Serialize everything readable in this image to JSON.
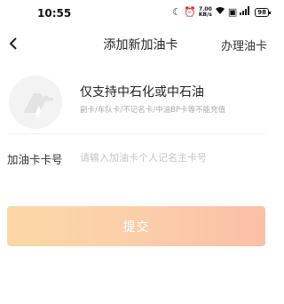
{
  "status_bar": {
    "time": "10:55",
    "network_speed_value": "7.00",
    "network_speed_unit": "KB/s",
    "signal_label": "5G",
    "battery": "98"
  },
  "nav": {
    "title": "添加新加油卡",
    "right_action": "办理油卡"
  },
  "info": {
    "title": "仅支持中石化或中石油",
    "subtitle": "副卡/车队卡/不记名卡/中油BP卡等不能充值"
  },
  "form": {
    "card_label": "加油卡卡号",
    "card_value": "",
    "card_placeholder": "请输入加油卡个人记名主卡号"
  },
  "submit_label": "提交",
  "colors": {
    "button_gradient_start": "#fbd8a6",
    "button_gradient_end": "#fbbfa6",
    "placeholder": "#c4c4c4",
    "icon_bg": "#f3f3f3"
  }
}
